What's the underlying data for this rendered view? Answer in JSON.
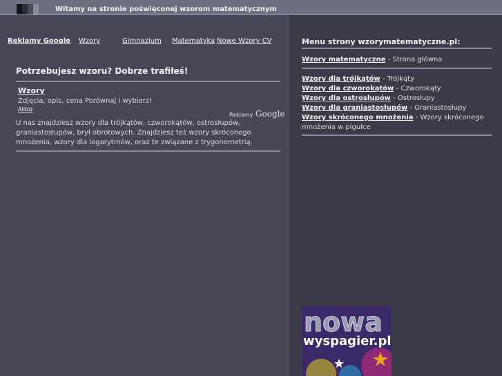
{
  "header": {
    "title": "Witamy na stronie poświęconej wzorom matematycznym"
  },
  "nav": {
    "ads_label": "Reklamy Google",
    "items": [
      "Wzory",
      "Gimnazjum",
      "Matematyka",
      "Nowe Wzory CV"
    ]
  },
  "main": {
    "heading": "Potrzebujesz wzoru? Dobrze trafiłeś!",
    "ad": {
      "title": "Wzory",
      "description": "Zdjęcia, opis, cena Porównaj i wybierz!",
      "url": "Allbiz",
      "ads_by_label": "Reklamy",
      "ads_by_brand": "Google"
    },
    "paragraph": "U nas znajdziesz wzory dla trójkątów, czworokątów, ostrosłupów, graniastosłupów, brył obrotowych. Znajdziesz też wzory skróconego mnożenia, wzory dla logarytmów, oraz te związane z trygonometrią."
  },
  "sidebar": {
    "title": "Menu strony wzorymatematyczne.pl:",
    "main_link": {
      "label": "Wzory matematyczne",
      "desc": " - Strona główna"
    },
    "links": [
      {
        "label": "Wzory dla trójkątów",
        "desc": " - Trójkąty"
      },
      {
        "label": "Wzory dla czworokątów",
        "desc": " - Czworokąty"
      },
      {
        "label": "Wzory dla ostrosłupów",
        "desc": " - Ostrosłupy"
      },
      {
        "label": "Wzory dla graniastosłupów",
        "desc": " - Graniastosłupy"
      },
      {
        "label": "Wzory skróconego mnożenia",
        "desc": " - Wzory skróconego mnożenia w pigułce"
      }
    ]
  },
  "banner": {
    "line1": "nowa",
    "line2": "wyspagier.pl"
  },
  "colors": {
    "background": "#6f6f82",
    "left_panel": "#464656",
    "right_panel": "#3b3b48",
    "banner": "#3a2a6a"
  }
}
